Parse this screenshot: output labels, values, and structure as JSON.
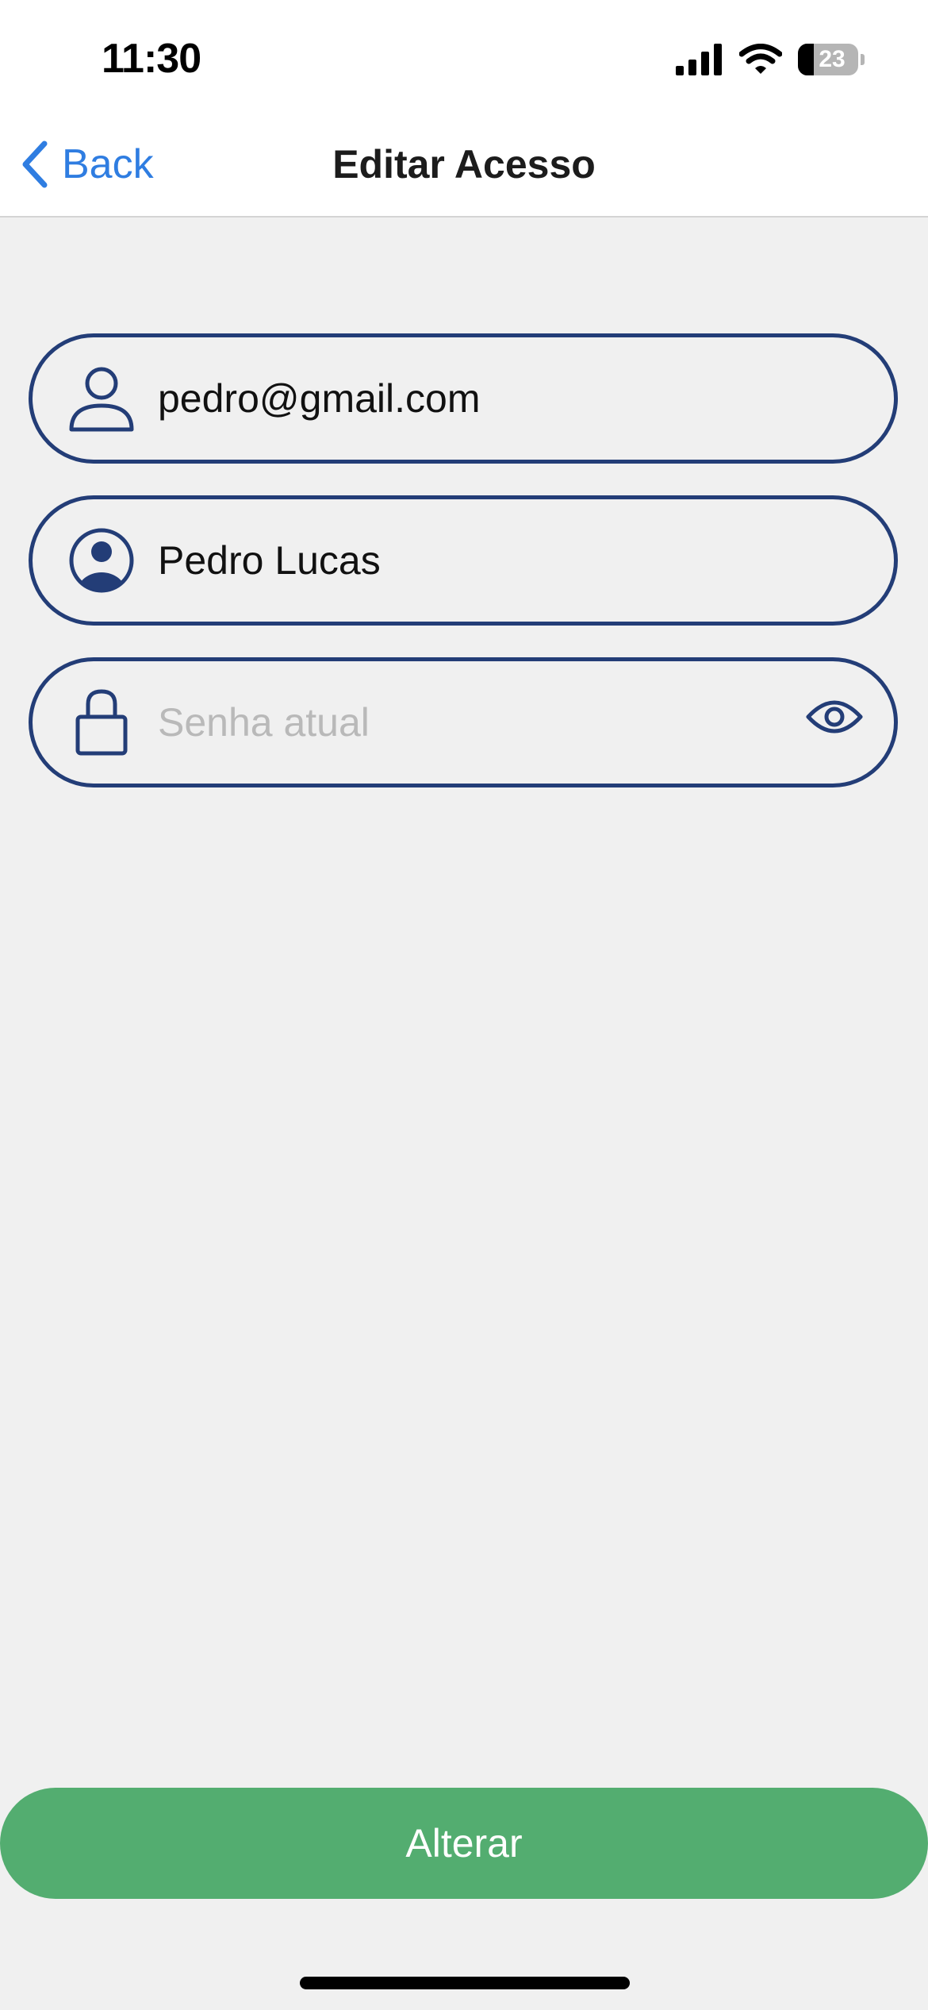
{
  "status_bar": {
    "time": "11:30",
    "battery_level": "23",
    "icons": [
      "signal-icon",
      "wifi-icon",
      "battery-icon"
    ]
  },
  "nav": {
    "back_label": "Back",
    "title": "Editar Acesso"
  },
  "form": {
    "email": {
      "value": "pedro@gmail.com",
      "icon": "user-outline-icon"
    },
    "name": {
      "value": "Pedro Lucas",
      "icon": "user-circle-icon"
    },
    "password": {
      "value": "",
      "placeholder": "Senha atual",
      "icon": "lock-icon",
      "toggle_icon": "eye-icon"
    }
  },
  "actions": {
    "submit_label": "Alterar"
  },
  "colors": {
    "accent": "#233d77",
    "link": "#2f7de1",
    "button": "#53ad70",
    "background": "#f0f0f0",
    "placeholder": "#b9b9b9"
  }
}
